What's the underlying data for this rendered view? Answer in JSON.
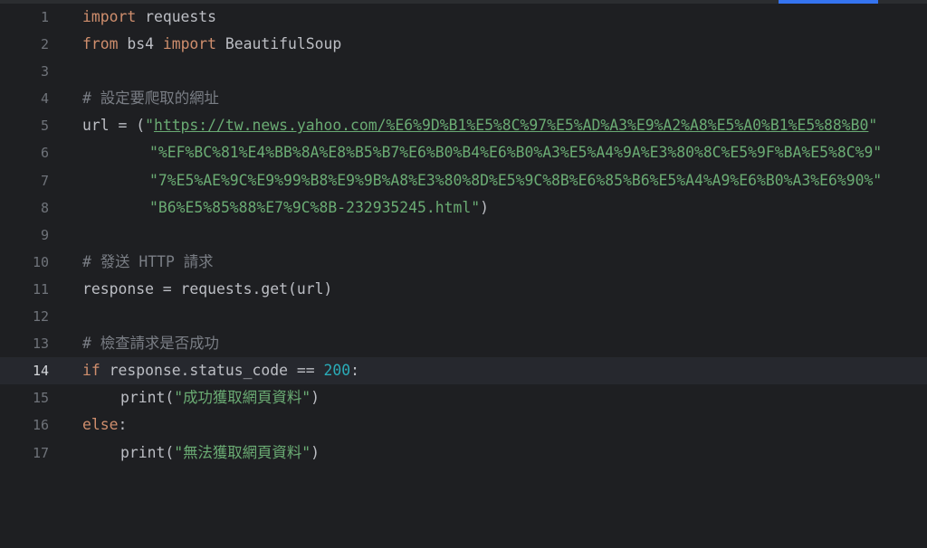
{
  "editor": {
    "current_line": "14",
    "lines": [
      {
        "num": "1",
        "tokens": [
          "import",
          " requests"
        ]
      },
      {
        "num": "2",
        "tokens": [
          "from",
          " bs4 ",
          "import",
          " BeautifulSoup"
        ]
      },
      {
        "num": "3",
        "tokens": []
      },
      {
        "num": "4",
        "tokens": [
          "# 設定要爬取的網址"
        ]
      },
      {
        "num": "5",
        "tokens": [
          "url = (",
          "\"",
          "https://tw.news.yahoo.com/%E6%9D%B1%E5%8C%97%E5%AD%A3%E9%A2%A8%E5%A0%B1%E5%88%B0",
          "\""
        ]
      },
      {
        "num": "6",
        "tokens": [
          "\"%EF%BC%81%E4%BB%8A%E8%B5%B7%E6%B0%B4%E6%B0%A3%E5%A4%9A%E3%80%8C%E5%9F%BA%E5%8C%9\""
        ]
      },
      {
        "num": "7",
        "tokens": [
          "\"7%E5%AE%9C%E9%99%B8%E9%9B%A8%E3%80%8D%E5%9C%8B%E6%85%B6%E5%A4%A9%E6%B0%A3%E6%90%\""
        ]
      },
      {
        "num": "8",
        "tokens": [
          "\"B6%E5%85%88%E7%9C%8B-232935245.html\"",
          ")"
        ]
      },
      {
        "num": "9",
        "tokens": []
      },
      {
        "num": "10",
        "tokens": [
          "# 發送 HTTP 請求"
        ]
      },
      {
        "num": "11",
        "tokens": [
          "response = requests.get(url)"
        ]
      },
      {
        "num": "12",
        "tokens": []
      },
      {
        "num": "13",
        "tokens": [
          "# 檢查請求是否成功"
        ]
      },
      {
        "num": "14",
        "tokens": [
          "if",
          " response.status_code == ",
          "200",
          ":"
        ]
      },
      {
        "num": "15",
        "tokens": [
          "print(",
          "\"成功獲取網頁資料\"",
          ")"
        ]
      },
      {
        "num": "16",
        "tokens": [
          "else",
          ":"
        ]
      },
      {
        "num": "17",
        "tokens": [
          "print(",
          "\"無法獲取網頁資料\"",
          ")"
        ]
      }
    ]
  },
  "colors": {
    "background": "#1e1f22",
    "keyword": "#cf8e6d",
    "string": "#6aab73",
    "comment": "#7a7e85",
    "number": "#2aacb8",
    "text": "#bcbec4",
    "tab_indicator": "#3574f0"
  }
}
